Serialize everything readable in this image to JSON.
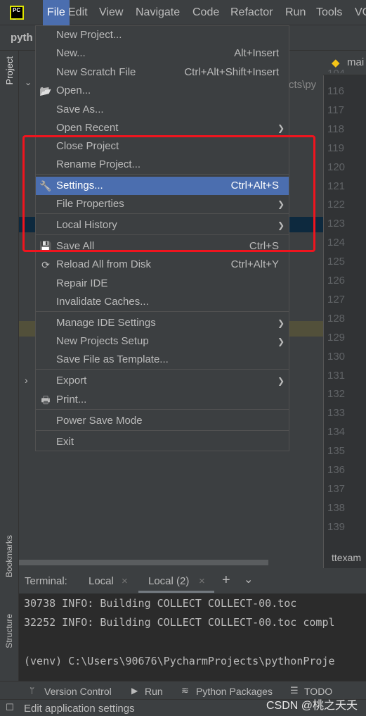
{
  "menubar": {
    "items": [
      "File",
      "Edit",
      "View",
      "Navigate",
      "Code",
      "Refactor",
      "Run",
      "Tools",
      "VC"
    ],
    "active": "File"
  },
  "navbar": {
    "project": "pyth"
  },
  "editor": {
    "tab": "mai",
    "path_fragment": "cts\\py",
    "line_numbers": [
      "104",
      "116",
      "117",
      "118",
      "119",
      "120",
      "121",
      "122",
      "123",
      "124",
      "125",
      "126",
      "127",
      "128",
      "129",
      "130",
      "131",
      "132",
      "133",
      "134",
      "135",
      "136",
      "137",
      "138",
      "139"
    ],
    "bottom_tab": "ttexam"
  },
  "sidebar": {
    "project": "Project",
    "bookmarks": "Bookmarks",
    "structure": "Structure"
  },
  "file_menu": {
    "items": [
      {
        "label": "New Project..."
      },
      {
        "label": "New...",
        "shortcut": "Alt+Insert"
      },
      {
        "label": "New Scratch File",
        "shortcut": "Ctrl+Alt+Shift+Insert"
      },
      {
        "label": "Open...",
        "icon": "folder-open-icon"
      },
      {
        "label": "Save As..."
      },
      {
        "label": "Open Recent",
        "submenu": true
      },
      {
        "label": "Close Project"
      },
      {
        "label": "Rename Project..."
      },
      {
        "label": "Settings...",
        "shortcut": "Ctrl+Alt+S",
        "icon": "wrench-icon",
        "highlighted": true
      },
      {
        "label": "File Properties",
        "submenu": true
      },
      {
        "label": "Local History",
        "submenu": true
      },
      {
        "label": "Save All",
        "shortcut": "Ctrl+S",
        "icon": "save-icon"
      },
      {
        "label": "Reload All from Disk",
        "shortcut": "Ctrl+Alt+Y",
        "icon": "reload-icon"
      },
      {
        "label": "Repair IDE"
      },
      {
        "label": "Invalidate Caches..."
      },
      {
        "label": "Manage IDE Settings",
        "submenu": true
      },
      {
        "label": "New Projects Setup",
        "submenu": true
      },
      {
        "label": "Save File as Template..."
      },
      {
        "label": "Export",
        "submenu": true
      },
      {
        "label": "Print...",
        "icon": "print-icon"
      },
      {
        "label": "Power Save Mode"
      },
      {
        "label": "Exit"
      }
    ]
  },
  "terminal": {
    "title": "Terminal:",
    "tabs": [
      "Local",
      "Local (2)"
    ],
    "active_tab": "Local (2)",
    "lines": [
      "30738 INFO: Building COLLECT COLLECT-00.toc",
      "32252 INFO: Building COLLECT COLLECT-00.toc compl",
      "",
      "(venv) C:\\Users\\90676\\PycharmProjects\\pythonProje"
    ]
  },
  "toolwindows": [
    "Version Control",
    "Run",
    "Python Packages",
    "TODO"
  ],
  "status": "Edit application settings",
  "watermark": "CSDN @桃之夭夭",
  "colors": {
    "highlight": "#4b6eaf",
    "annotation_box": "#f0141e"
  }
}
